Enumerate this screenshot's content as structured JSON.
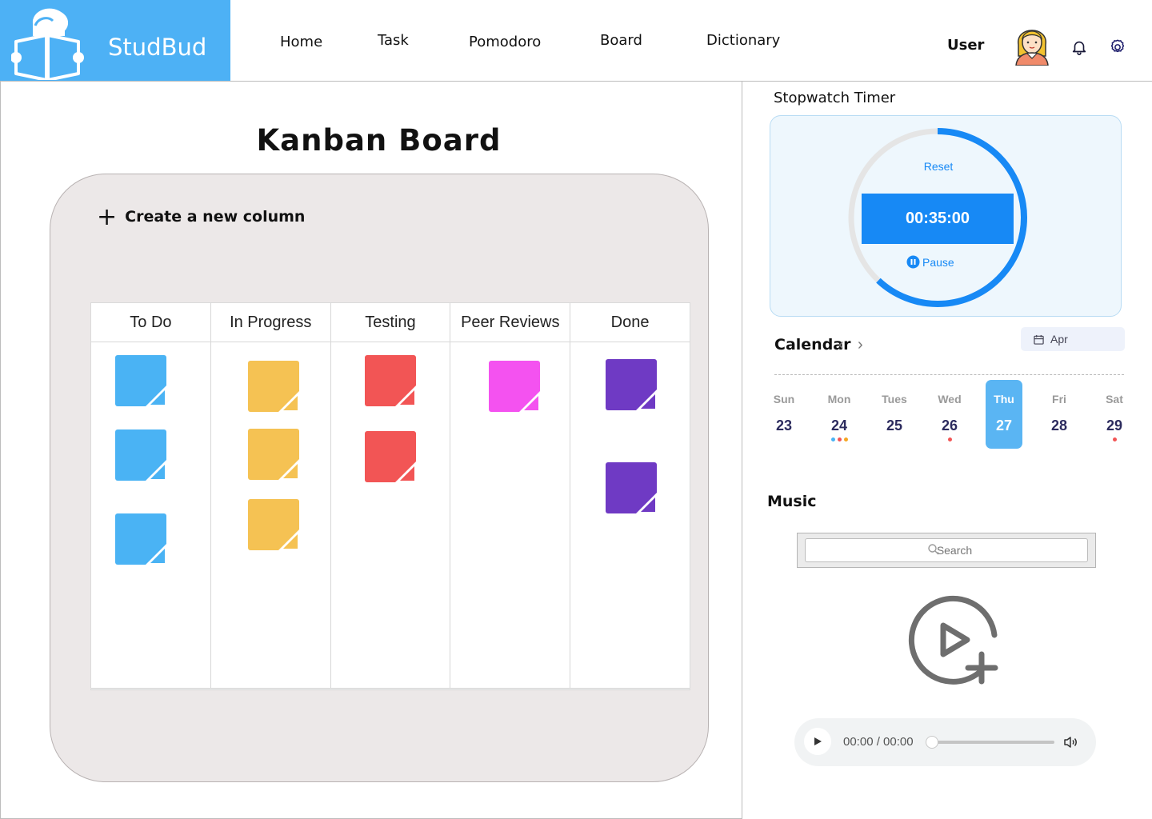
{
  "app": {
    "brand": "StudBud",
    "brand_color": "#4db1f5"
  },
  "nav": {
    "home": "Home",
    "task": "Task",
    "pomodoro": "Pomodoro",
    "board": "Board",
    "dictionary": "Dictionary"
  },
  "user": {
    "label": "User"
  },
  "board": {
    "title": "Kanban Board",
    "create_column": "Create a new column",
    "columns": [
      {
        "label": "To Do",
        "note_color": "#4ab3f4",
        "note_count": 3
      },
      {
        "label": "In Progress",
        "note_color": "#f5c253",
        "note_count": 3
      },
      {
        "label": "Testing",
        "note_color": "#f25555",
        "note_count": 2
      },
      {
        "label": "Peer Reviews",
        "note_color": "#f452f0",
        "note_count": 1
      },
      {
        "label": "Done",
        "note_color": "#6f3ac4",
        "note_count": 2
      }
    ]
  },
  "stopwatch": {
    "title": "Stopwatch Timer",
    "reset": "Reset",
    "time": "00:35:00",
    "pause": "Pause",
    "progress": 0.62,
    "accent": "#1789f5"
  },
  "calendar": {
    "title": "Calendar",
    "month": "Apr",
    "days": [
      {
        "name": "Sun",
        "num": "23"
      },
      {
        "name": "Mon",
        "num": "24"
      },
      {
        "name": "Tues",
        "num": "25"
      },
      {
        "name": "Wed",
        "num": "26"
      },
      {
        "name": "Thu",
        "num": "27"
      },
      {
        "name": "Fri",
        "num": "28"
      },
      {
        "name": "Sat",
        "num": "29"
      }
    ],
    "selected_day": "Thu"
  },
  "music": {
    "title": "Music",
    "search_placeholder": "Search",
    "player_time": "00:00 / 00:00"
  }
}
